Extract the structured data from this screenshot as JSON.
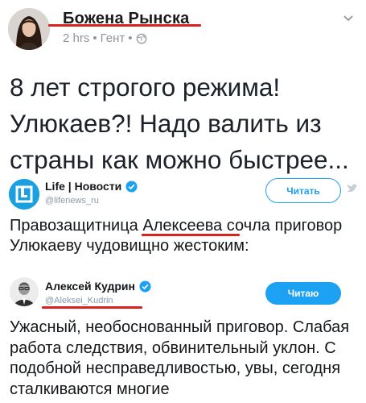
{
  "post": {
    "author": "Божена Рынска",
    "time": "2 hrs",
    "location": "Гент",
    "separator": "•",
    "text": "8 лет строгого режима! Улюкаев?! Надо валить из страны как можно быстрее..."
  },
  "embed_life": {
    "name": "Life | Новости",
    "handle": "@lifenews_ru",
    "follow_label": "Читать",
    "text_before": "Правозащитница ",
    "text_highlight": "Алексеева",
    "text_after": " сочла приговор Улюкаеву чудовищно жестоким:"
  },
  "embed_kudrin": {
    "name": "Алексей Кудрин",
    "handle": "@Aleksei_Kudrin",
    "follow_label": "Читаю",
    "text": "Ужасный, необоснованный приговор. Слабая работа следствия, обвинительный уклон. С подобной несправедливостью, увы, сегодня сталкиваются многие"
  },
  "colors": {
    "accent": "#1da1f2",
    "underline": "#d9231f"
  },
  "icons": [
    "globe-icon",
    "more-icon",
    "verified-icon",
    "life-logo-icon",
    "twitter-bird-icon"
  ]
}
